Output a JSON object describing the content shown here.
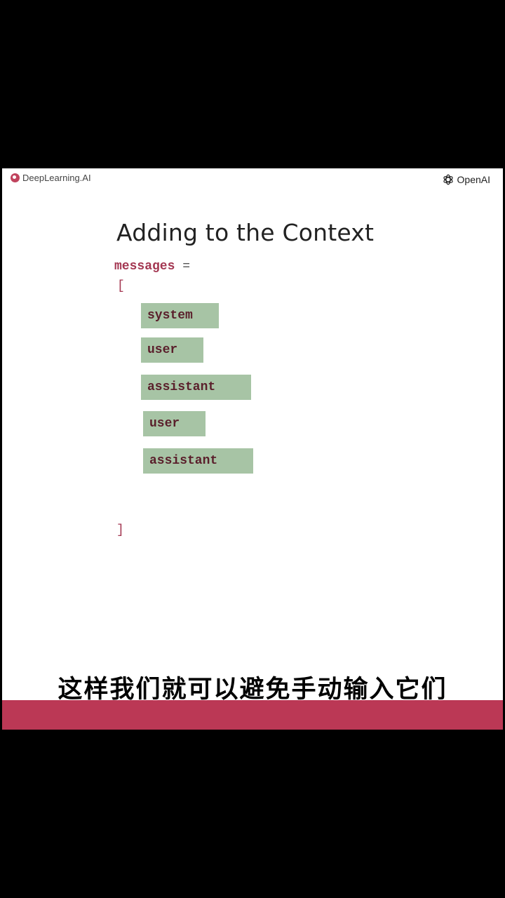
{
  "header": {
    "left_brand": "DeepLearning.AI",
    "right_brand": "OpenAI"
  },
  "slide": {
    "title": "Adding to the Context",
    "code_var": "messages",
    "code_eq": "=",
    "open_bracket": "[",
    "close_bracket": "]",
    "roles": [
      "system",
      "user",
      "assistant",
      "user",
      "assistant"
    ]
  },
  "caption": "这样我们就可以避免手动输入它们",
  "colors": {
    "accent": "#bb3855",
    "role_box": "#a7c4a5",
    "code_text": "#a33651"
  },
  "icons": {
    "left_logo": "deeplearning-ai-logo",
    "right_logo": "openai-logo"
  }
}
